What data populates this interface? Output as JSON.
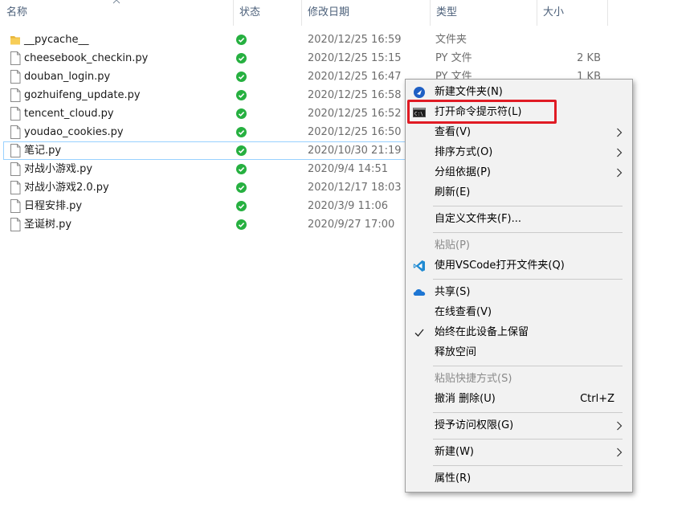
{
  "columns": {
    "name": "名称",
    "status": "状态",
    "modified": "修改日期",
    "type": "类型",
    "size": "大小"
  },
  "files": [
    {
      "name": "__pycache__",
      "date": "2020/12/25 16:59",
      "type": "文件夹",
      "size": "",
      "kind": "folder"
    },
    {
      "name": "cheesebook_checkin.py",
      "date": "2020/12/25 15:15",
      "type": "PY 文件",
      "size": "2 KB",
      "kind": "file"
    },
    {
      "name": "douban_login.py",
      "date": "2020/12/25 16:47",
      "type": "PY 文件",
      "size": "1 KB",
      "kind": "file"
    },
    {
      "name": "gozhuifeng_update.py",
      "date": "2020/12/25 16:58",
      "type": "",
      "size": "",
      "kind": "file"
    },
    {
      "name": "tencent_cloud.py",
      "date": "2020/12/25 16:52",
      "type": "",
      "size": "",
      "kind": "file"
    },
    {
      "name": "youdao_cookies.py",
      "date": "2020/12/25 16:50",
      "type": "",
      "size": "",
      "kind": "file"
    },
    {
      "name": "笔记.py",
      "date": "2020/10/30 21:19",
      "type": "",
      "size": "",
      "kind": "file"
    },
    {
      "name": "对战小游戏.py",
      "date": "2020/9/4 14:51",
      "type": "",
      "size": "",
      "kind": "file"
    },
    {
      "name": "对战小游戏2.0.py",
      "date": "2020/12/17 18:03",
      "type": "",
      "size": "",
      "kind": "file"
    },
    {
      "name": "日程安排.py",
      "date": "2020/3/9 11:06",
      "type": "",
      "size": "",
      "kind": "file"
    },
    {
      "name": "圣诞树.py",
      "date": "2020/9/27 17:00",
      "type": "",
      "size": "",
      "kind": "file"
    }
  ],
  "status_color": "#26b040",
  "context_menu": {
    "new_folder": "新建文件夹(N)",
    "open_cmd": "打开命令提示符(L)",
    "view": "查看(V)",
    "sort_by": "排序方式(O)",
    "group_by": "分组依据(P)",
    "refresh": "刷新(E)",
    "customize_folder": "自定义文件夹(F)...",
    "paste": "粘贴(P)",
    "open_with_vscode": "使用VSCode打开文件夹(Q)",
    "share": "共享(S)",
    "view_online": "在线查看(V)",
    "always_keep": "始终在此设备上保留",
    "free_up_space": "释放空间",
    "paste_shortcut": "粘贴快捷方式(S)",
    "undo_delete": "撤消 删除(U)",
    "undo_shortcut": "Ctrl+Z",
    "give_access": "授予访问权限(G)",
    "new": "新建(W)",
    "properties": "属性(R)"
  },
  "highlight_color": "#e01b24"
}
